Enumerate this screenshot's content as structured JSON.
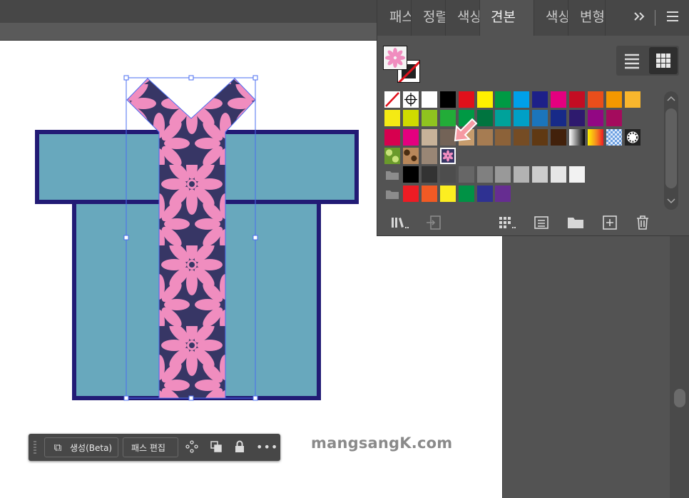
{
  "panel": {
    "tabs": [
      "패스",
      "정렬",
      "색상",
      "견본",
      "색상",
      "변형"
    ],
    "active_tab": 3,
    "expand_icon": "double-chevron-right-icon",
    "menu_icon": "hamburger-menu-icon"
  },
  "swatch_rows": [
    [
      "none",
      "registration",
      "#ffffff",
      "#000000",
      "#e0101b",
      "#fff100",
      "#009a44",
      "#00a0e9",
      "#1d2088",
      "#e4007f",
      "#c30d23",
      "#e94e1b",
      "#f39800",
      "#f8b62d"
    ],
    [
      "#f5ea14",
      "#cfdb00",
      "#8fc31f",
      "#22ac38",
      "#009944",
      "#00743f",
      "#00a29a",
      "#00a0c6",
      "#1b75bc",
      "#172a88",
      "#2e1a6e",
      "#920783",
      "#a40b5d"
    ],
    [
      "#d7004f",
      "#e4007f",
      "#c7b299",
      "#736357",
      "#c69c6d",
      "#a67c52",
      "#8c6239",
      "#754c24",
      "#603913",
      "#42210b",
      "gradient-bw",
      "gradient-orange",
      "pattern-blue",
      "pattern-dots"
    ],
    [
      "pattern-green",
      "pattern-leopard",
      "#998675",
      "pattern-flower"
    ],
    [
      "folder",
      "#000000",
      "#333333",
      "#4d4d4d",
      "#666666",
      "#808080",
      "#999999",
      "#b3b3b3",
      "#cccccc",
      "#e6e6e6",
      "#f2f2f2"
    ],
    [
      "folder",
      "#ed1c24",
      "#f15a24",
      "#fcee21",
      "#009245",
      "#2e3192",
      "#662d91"
    ]
  ],
  "taskbar": {
    "generate_label": "생성(Beta)",
    "edit_path_label": "패스 편집"
  },
  "watermark": "mangsangK.com",
  "colors": {
    "gift_box": "#68a8bd",
    "gift_outline": "#221b75",
    "ribbon": "#373665",
    "flower": "#f08dbf",
    "selection": "#4a6cf0"
  }
}
